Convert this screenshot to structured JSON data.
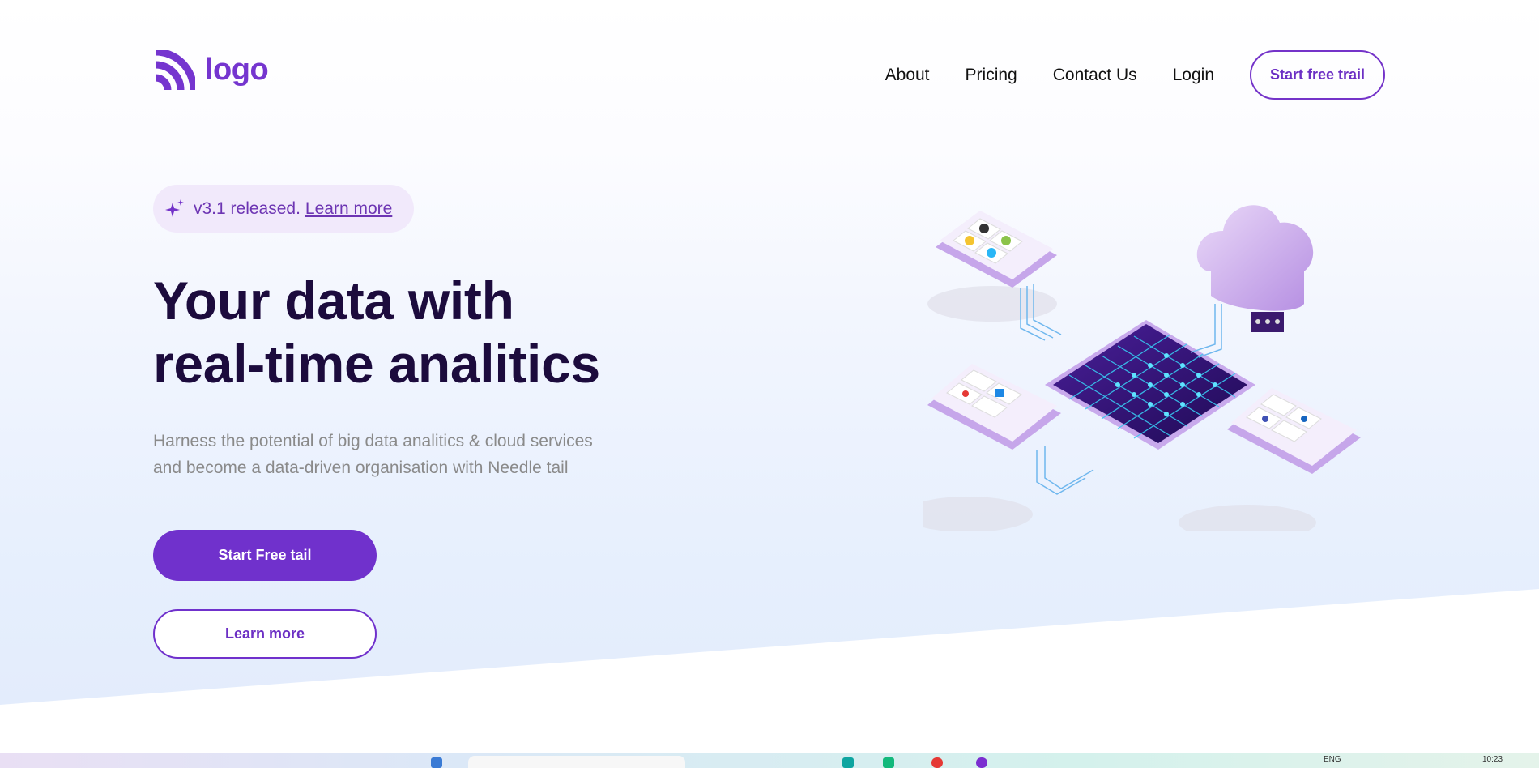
{
  "colors": {
    "brand": "#7031cc",
    "headline": "#1c0b3d",
    "badge_bg": "#f1e9fb",
    "subtext": "#8a8a8a"
  },
  "header": {
    "logo_text": "logo",
    "nav": [
      {
        "label": "About"
      },
      {
        "label": "Pricing"
      },
      {
        "label": "Contact Us"
      },
      {
        "label": "Login"
      }
    ],
    "cta_label": "Start free trail"
  },
  "hero": {
    "badge_text": "v3.1 released.",
    "badge_link": "Learn more",
    "headline_line1": "Your data with",
    "headline_line2": "real-time analitics",
    "sub_line1": "Harness the potential of big data analitics & cloud services",
    "sub_line2": "and become a data-driven organisation with Needle tail",
    "primary_button": "Start Free tail",
    "secondary_button": "Learn more",
    "illustration_icon": "isometric-data-platform-illustration"
  },
  "taskbar": {
    "lang": "ENG",
    "time": "10:23"
  }
}
